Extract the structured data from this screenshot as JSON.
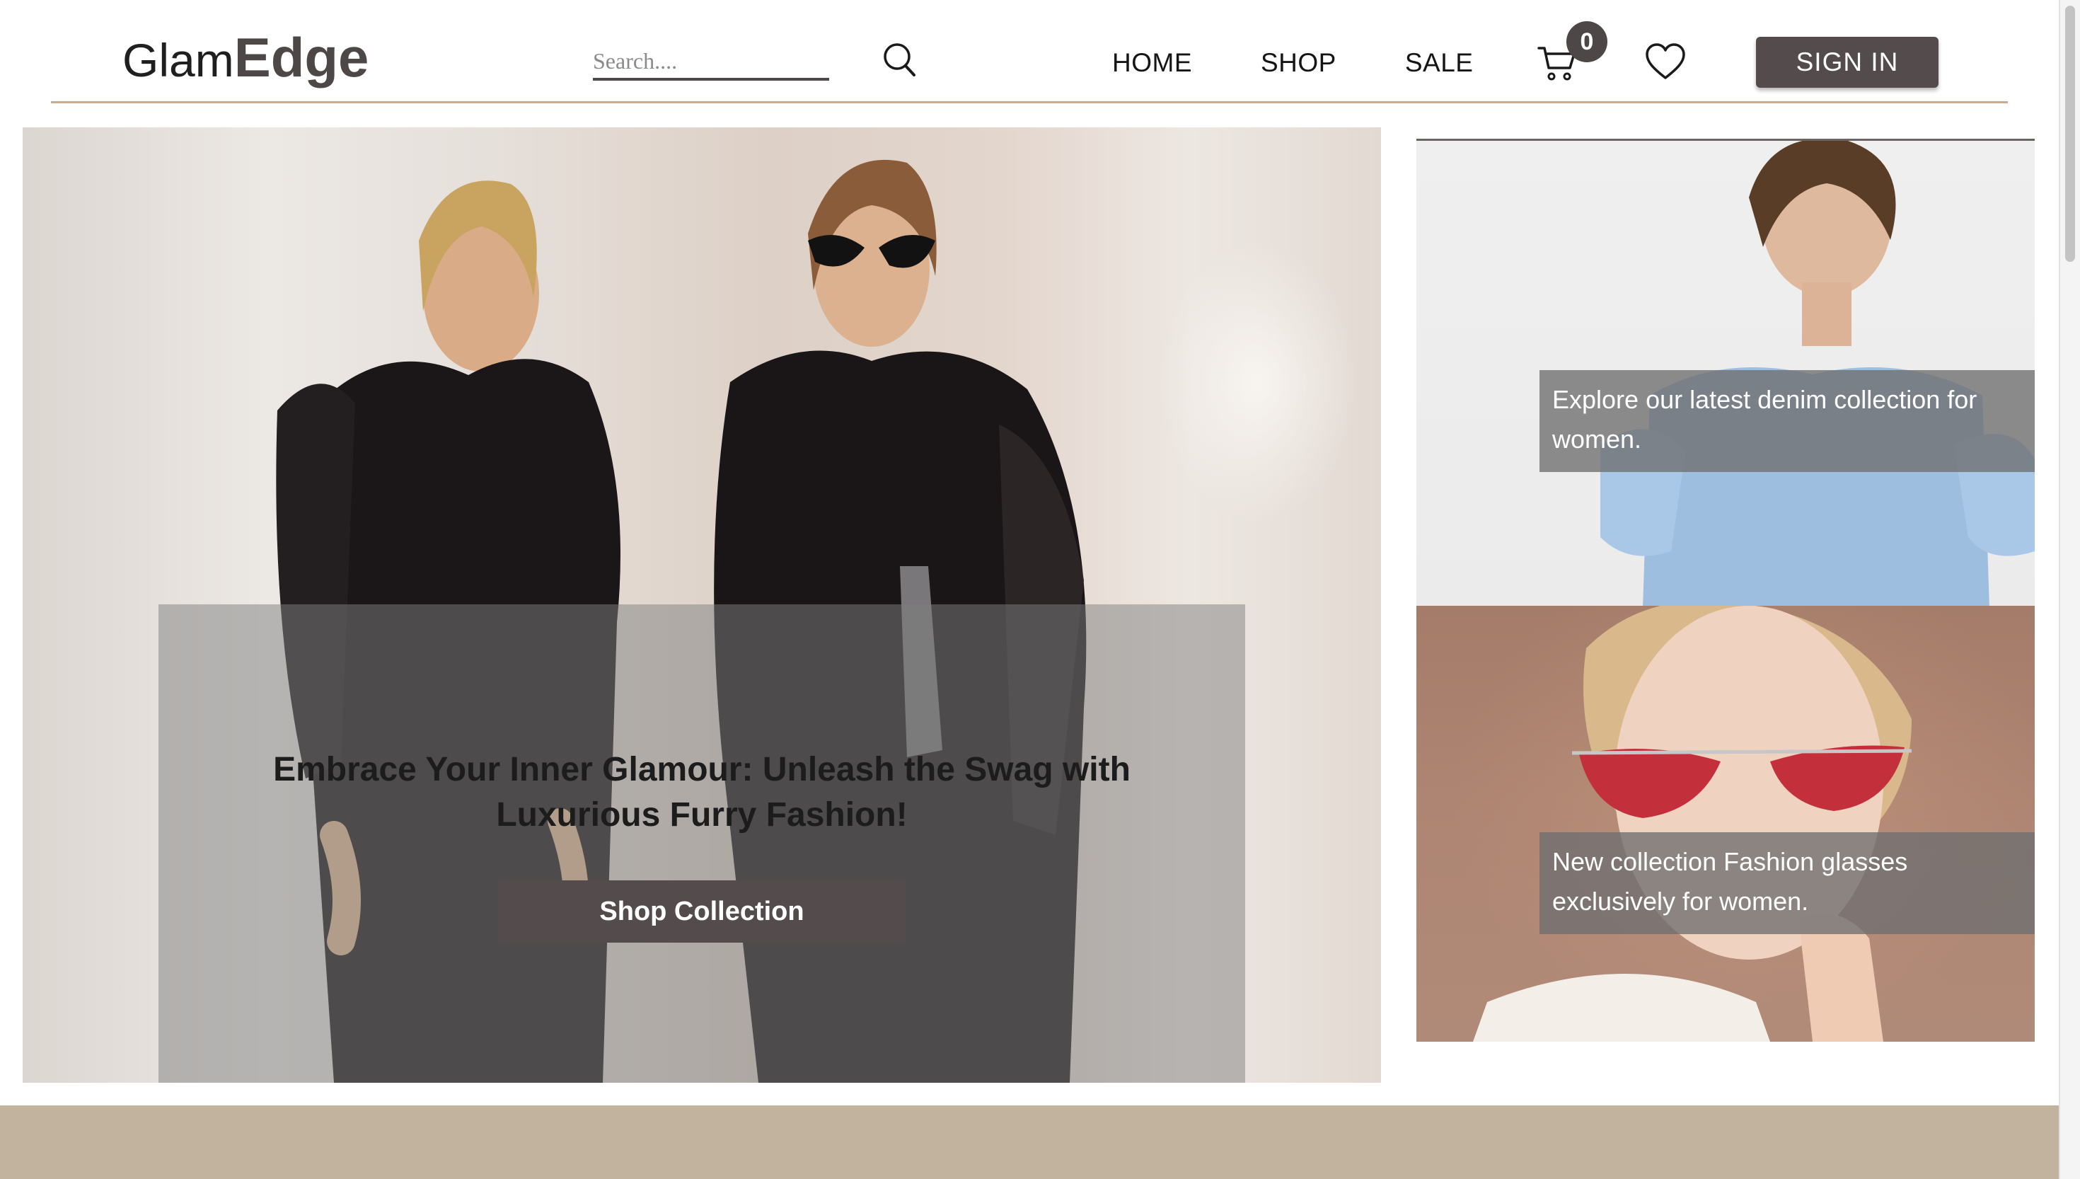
{
  "brand": {
    "part1": "Glam",
    "part2": "Edge"
  },
  "search": {
    "placeholder": "Search....",
    "value": "",
    "icon": "search-icon"
  },
  "nav": [
    {
      "label": "HOME"
    },
    {
      "label": "SHOP"
    },
    {
      "label": "SALE"
    }
  ],
  "cart": {
    "count": "0",
    "icon": "cart-icon"
  },
  "wishlist": {
    "icon": "heart-icon"
  },
  "signin": {
    "label": "SIGN IN"
  },
  "hero": {
    "headline": "Embrace Your Inner Glamour: Unleash the Swag with Luxurious Furry Fashion!",
    "cta": "Shop Collection"
  },
  "promos": [
    {
      "caption": "Explore our latest denim collection for women."
    },
    {
      "caption": "New collection Fashion glasses exclusively for women."
    }
  ],
  "colors": {
    "accent": "#544c4c",
    "header_rule": "#c9ab8f",
    "footer_band": "#c1b39e",
    "badge": "#4e4747"
  }
}
